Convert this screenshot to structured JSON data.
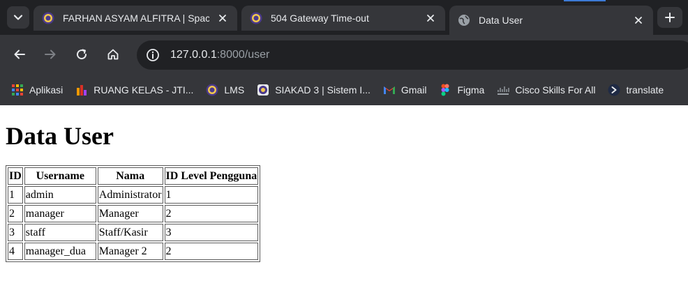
{
  "browser": {
    "tabs": [
      {
        "title": "FARHAN ASYAM ALFITRA | Spac",
        "icon": "university-seal-icon"
      },
      {
        "title": "504 Gateway Time-out",
        "icon": "university-seal-icon"
      },
      {
        "title": "Data User",
        "icon": "globe-icon"
      }
    ],
    "url": {
      "host": "127.0.0.1",
      "rest": ":8000/user"
    },
    "bookmarks": [
      {
        "label": "Aplikasi",
        "icon": "apps-grid-icon"
      },
      {
        "label": "RUANG KELAS - JTI...",
        "icon": "ruang-kelas-icon"
      },
      {
        "label": "LMS",
        "icon": "university-seal-icon"
      },
      {
        "label": "SIAKAD 3 | Sistem I...",
        "icon": "siakad-icon"
      },
      {
        "label": "Gmail",
        "icon": "gmail-icon"
      },
      {
        "label": "Figma",
        "icon": "figma-icon"
      },
      {
        "label": "Cisco Skills For All",
        "icon": "cisco-icon"
      },
      {
        "label": "translate",
        "icon": "translate-icon"
      }
    ]
  },
  "page": {
    "title": "Data User",
    "table": {
      "headers": [
        "ID",
        "Username",
        "Nama",
        "ID Level Pengguna"
      ],
      "rows": [
        [
          "1",
          "admin",
          "Administrator",
          "1"
        ],
        [
          "2",
          "manager",
          "Manager",
          "2"
        ],
        [
          "3",
          "staff",
          "Staff/Kasir",
          "3"
        ],
        [
          "4",
          "manager_dua",
          "Manager 2",
          "2"
        ]
      ]
    }
  },
  "colors": {
    "chrome_dark": "#202124",
    "chrome_toolbar": "#35363a",
    "text_light": "#e8eaed"
  }
}
